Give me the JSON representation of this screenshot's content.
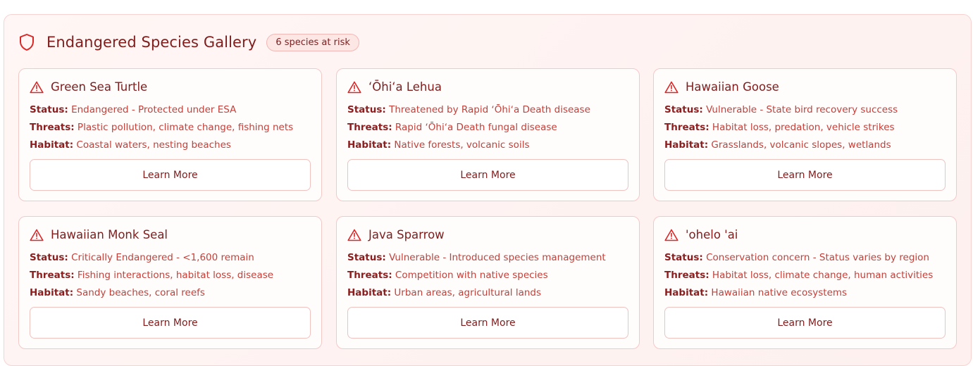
{
  "gallery": {
    "title": "Endangered Species Gallery",
    "badge": "6 species at risk",
    "accent_color": "#dc2626",
    "header_icon": "shield-icon",
    "card_icon": "warning-triangle-icon"
  },
  "labels": {
    "status": "Status:",
    "threats": "Threats:",
    "habitat": "Habitat:"
  },
  "species": [
    {
      "name": "Green Sea Turtle",
      "status": " Endangered - Protected under ESA",
      "threats": " Plastic pollution, climate change, fishing nets",
      "habitat": " Coastal waters, nesting beaches",
      "button": "Learn More"
    },
    {
      "name": "ʻŌhiʻa Lehua",
      "status": " Threatened by Rapid ʻŌhiʻa Death disease",
      "threats": " Rapid ʻŌhiʻa Death fungal disease",
      "habitat": " Native forests, volcanic soils",
      "button": "Learn More"
    },
    {
      "name": "Hawaiian Goose",
      "status": " Vulnerable - State bird recovery success",
      "threats": " Habitat loss, predation, vehicle strikes",
      "habitat": " Grasslands, volcanic slopes, wetlands",
      "button": "Learn More"
    },
    {
      "name": "Hawaiian Monk Seal",
      "status": " Critically Endangered - <1,600 remain",
      "threats": " Fishing interactions, habitat loss, disease",
      "habitat": " Sandy beaches, coral reefs",
      "button": "Learn More"
    },
    {
      "name": "Java Sparrow",
      "status": " Vulnerable - Introduced species management",
      "threats": " Competition with native species",
      "habitat": " Urban areas, agricultural lands",
      "button": "Learn More"
    },
    {
      "name": "'ohelo 'ai",
      "status": " Conservation concern - Status varies by region",
      "threats": " Habitat loss, climate change, human activities",
      "habitat": " Hawaiian native ecosystems",
      "button": "Learn More"
    }
  ]
}
